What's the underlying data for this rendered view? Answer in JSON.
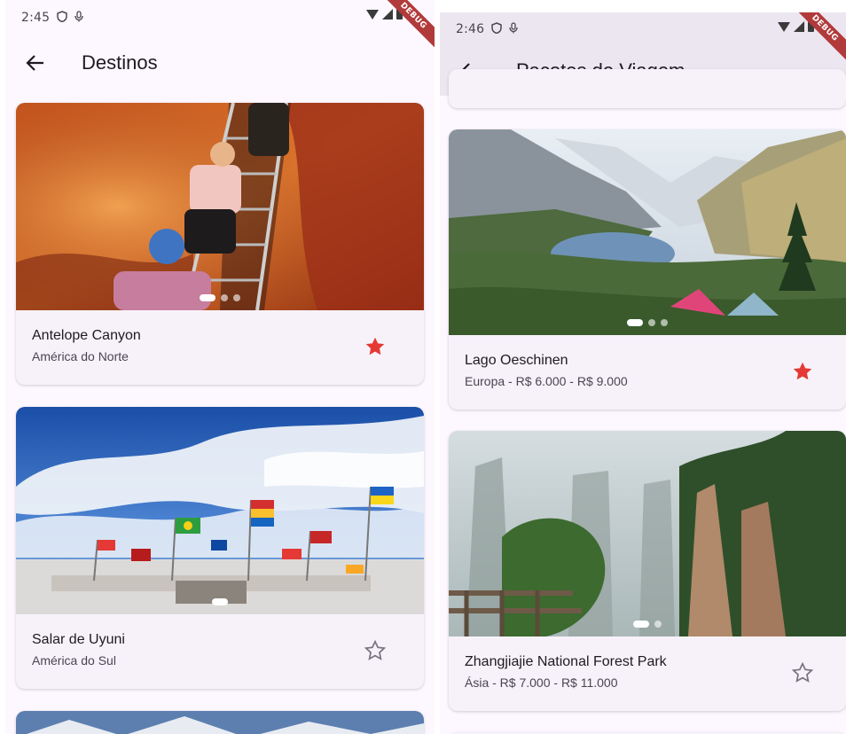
{
  "left": {
    "status": {
      "time": "2:45"
    },
    "debug_label": "DEBUG",
    "app_bar": {
      "title": "Destinos"
    },
    "cards": [
      {
        "title": "Antelope Canyon",
        "subtitle": "América do Norte",
        "favorite": true,
        "dots": 3,
        "active_dot": 0
      },
      {
        "title": "Salar de Uyuni",
        "subtitle": "América do Sul",
        "favorite": false,
        "dots": 1,
        "active_dot": 0
      }
    ]
  },
  "right": {
    "status": {
      "time": "2:46"
    },
    "debug_label": "DEBUG",
    "app_bar": {
      "title": "Pacotes de Viagem"
    },
    "cards": [
      {
        "title": "Lago Oeschinen",
        "subtitle": "Europa - R$ 6.000 - R$ 9.000",
        "favorite": true,
        "dots": 3,
        "active_dot": 0
      },
      {
        "title": "Zhangjiajie National Forest Park",
        "subtitle": "Ásia - R$ 7.000 - R$ 11.000",
        "favorite": false,
        "dots": 2,
        "active_dot": 0
      }
    ]
  },
  "colors": {
    "favorite_active": "#e53935",
    "favorite_inactive": "#79747e",
    "surface": "#fdf7ff",
    "card": "#f7f2fa",
    "app_bar_right": "#ece6f0"
  }
}
